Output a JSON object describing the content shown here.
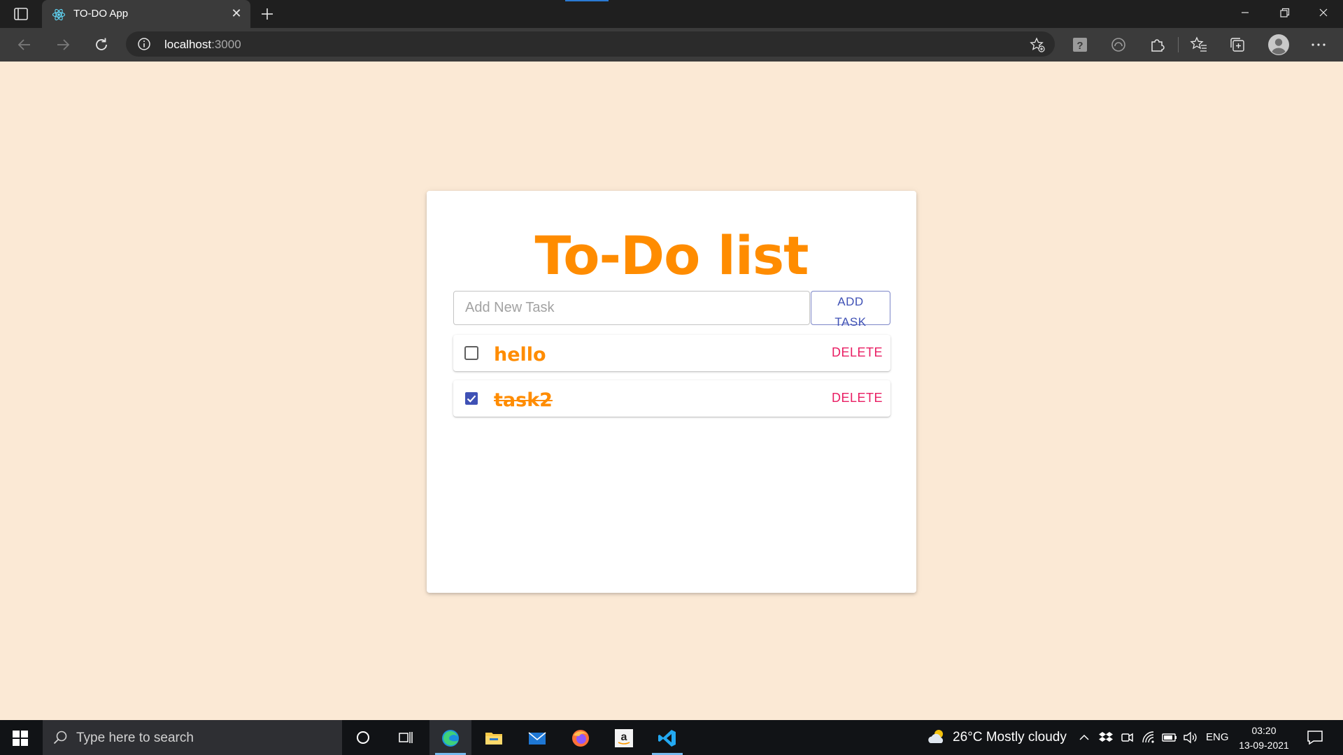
{
  "browser": {
    "tab_title": "TO-DO App",
    "tab_close_glyph": "✕",
    "address_host": "localhost",
    "address_port": ":3000"
  },
  "app": {
    "heading": "To-Do list",
    "input_placeholder": "Add New Task",
    "input_value": "",
    "add_button_line1": "ADD",
    "add_button_line2": "TASK",
    "tasks": [
      {
        "text": "hello",
        "done": false,
        "delete_label": "DELETE"
      },
      {
        "text": "task2",
        "done": true,
        "delete_label": "DELETE"
      }
    ],
    "colors": {
      "page_bg": "#fbe9d5",
      "heading": "#ff8c00",
      "primary": "#3f51b5",
      "delete": "#e91e63"
    }
  },
  "taskbar": {
    "search_placeholder": "Type here to search",
    "weather": "26°C  Mostly cloudy",
    "language": "ENG",
    "time": "03:20",
    "date": "13-09-2021",
    "apps": [
      "edge-icon",
      "file-explorer-icon",
      "mail-icon",
      "firefox-icon",
      "amazon-icon",
      "vscode-icon"
    ]
  }
}
